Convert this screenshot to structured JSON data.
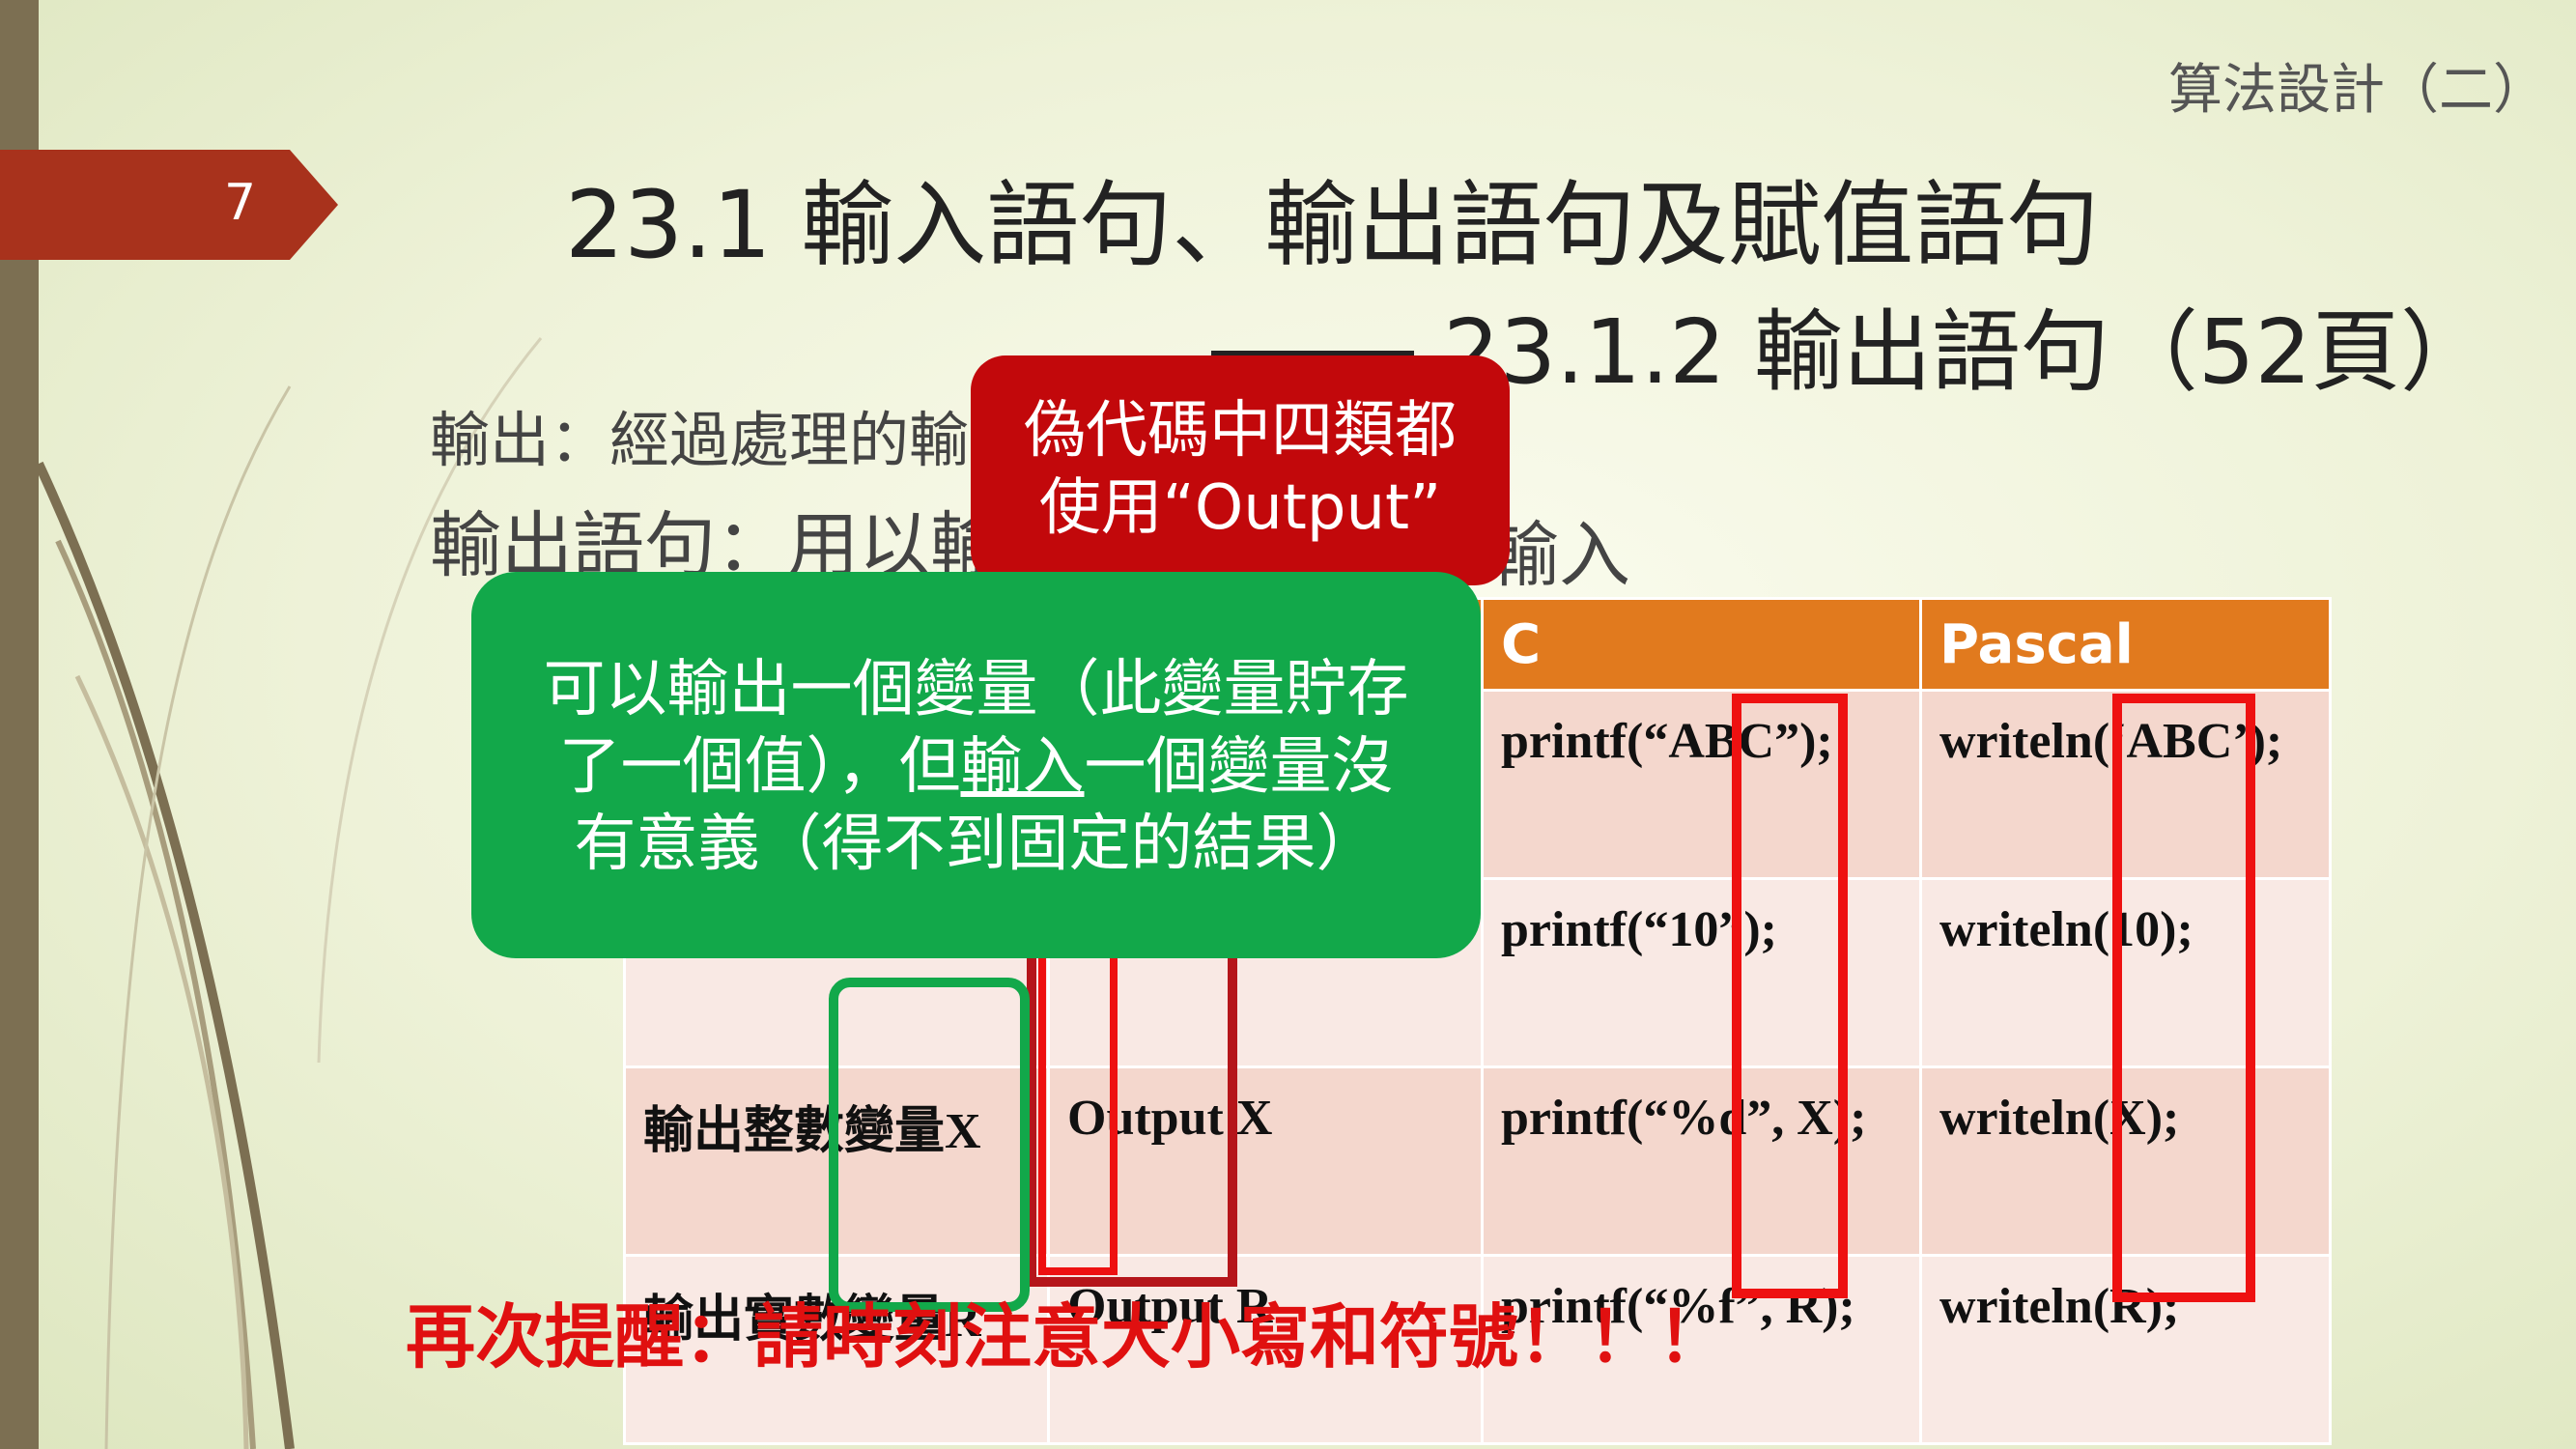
{
  "slide": {
    "course_title": "算法設計（二）",
    "number": "7",
    "title": "23.1 輸入語句、輸出語句及賦值語句",
    "subtitle": "23.1.2 輸出語句（52頁）"
  },
  "body": {
    "line1": "輸出：經過處理的輸",
    "line2": "輸出語句：用以輸",
    "line2_tail": "輸入"
  },
  "table": {
    "headers": [
      "",
      "",
      "C",
      "Pascal"
    ],
    "rows": [
      [
        "",
        "",
        "printf(“ABC”);",
        "writeln(‘ABC’);"
      ],
      [
        "",
        "",
        "printf(“10”);",
        "writeln(10);"
      ],
      [
        "輸出整數變量X",
        "Output X",
        "printf(“%d”, X);",
        "writeln(X);"
      ],
      [
        "輸出實數變量R",
        "Output R",
        "printf(“%f”, R);",
        "writeln(R);"
      ]
    ]
  },
  "callouts": {
    "red_line1": "偽代碼中四類都",
    "red_line2": "使用“Output”",
    "green_line1": "可以輸出一個變量（此變量貯存",
    "green_line2_a": "了一個值），但",
    "green_line2_u": "輸入",
    "green_line2_b": "一個變量沒",
    "green_line3": "有意義（得不到固定的結果）"
  },
  "reminder": "再次提醒：請時刻注意大小寫和符號！！！",
  "colors": {
    "accent_red": "#c2080b",
    "accent_green": "#12a84a",
    "header_orange": "#e17a1e",
    "tag_red": "#a8321c"
  }
}
